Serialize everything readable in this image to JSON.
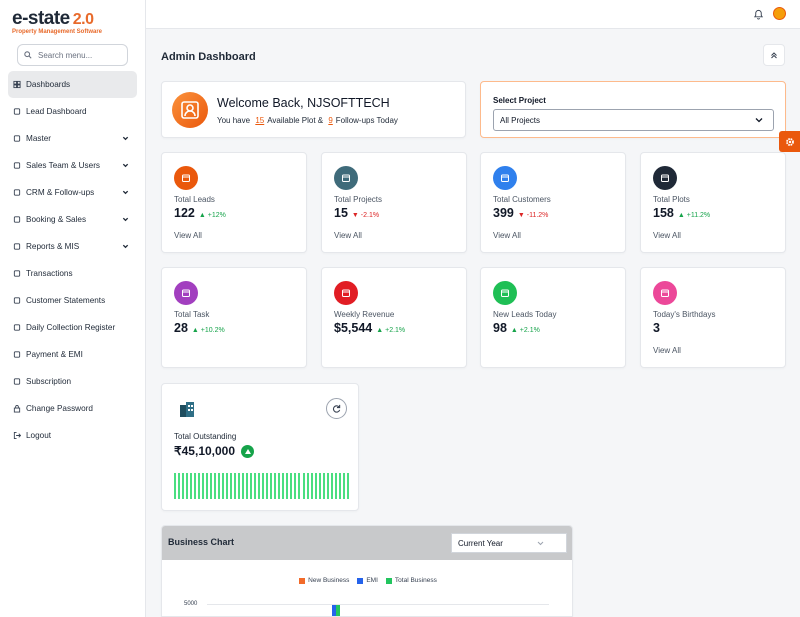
{
  "brand": {
    "name": "e-state",
    "version": "2.0",
    "tagline": "Property Management Software",
    "accent": "#e86a2b"
  },
  "sidebar": {
    "search_placeholder": "Search menu...",
    "items": [
      {
        "label": "Dashboards",
        "icon": "dashboard-icon",
        "active": true,
        "expandable": false
      },
      {
        "label": "Lead Dashboard",
        "icon": "lead-dashboard-icon",
        "expandable": false
      },
      {
        "label": "Master",
        "icon": "folder-icon",
        "expandable": true
      },
      {
        "label": "Sales Team & Users",
        "icon": "users-icon",
        "expandable": true
      },
      {
        "label": "CRM & Follow-ups",
        "icon": "crm-icon",
        "expandable": true
      },
      {
        "label": "Booking & Sales",
        "icon": "home-icon",
        "expandable": true
      },
      {
        "label": "Reports & MIS",
        "icon": "report-icon",
        "expandable": true
      },
      {
        "label": "Transactions",
        "icon": "transactions-icon",
        "expandable": false
      },
      {
        "label": "Customer Statements",
        "icon": "statement-icon",
        "expandable": false
      },
      {
        "label": "Daily Collection Register",
        "icon": "register-icon",
        "expandable": false
      },
      {
        "label": "Payment & EMI",
        "icon": "payment-icon",
        "expandable": false
      },
      {
        "label": "Subscription",
        "icon": "subscription-icon",
        "expandable": false
      },
      {
        "label": "Change Password",
        "icon": "lock-icon",
        "expandable": false
      },
      {
        "label": "Logout",
        "icon": "logout-icon",
        "expandable": false
      }
    ]
  },
  "header": {
    "title": "Admin Dashboard"
  },
  "welcome": {
    "title": "Welcome Back, NJSOFTTECH",
    "prefix": "You have",
    "plots": "15",
    "plots_text": "Available Plot &",
    "followups": "9",
    "followups_text": "Follow-ups Today"
  },
  "project": {
    "label": "Select Project",
    "selected": "All Projects"
  },
  "stats": [
    {
      "label": "Total Leads",
      "value": "122",
      "change": "+12%",
      "direction": "up",
      "link": "View All",
      "color": "#ea580c",
      "icon": "calendar-icon"
    },
    {
      "label": "Total Projects",
      "value": "15",
      "change": "-2.1%",
      "direction": "down",
      "link": "View All",
      "color": "#3f6b7a",
      "icon": "calendar-icon"
    },
    {
      "label": "Total Customers",
      "value": "399",
      "change": "-11.2%",
      "direction": "down",
      "link": "View All",
      "color": "#2f80ed",
      "icon": "users-icon"
    },
    {
      "label": "Total Plots",
      "value": "158",
      "change": "+11.2%",
      "direction": "up",
      "link": "View All",
      "color": "#1f2937",
      "icon": "plot-icon"
    },
    {
      "label": "Total Task",
      "value": "28",
      "change": "+10.2%",
      "direction": "up",
      "link": "",
      "color": "#a23fbf",
      "icon": "task-icon"
    },
    {
      "label": "Weekly Revenue",
      "value": "$5,544",
      "change": "+2.1%",
      "direction": "up",
      "link": "",
      "color": "#e11d24",
      "icon": "calendar-icon"
    },
    {
      "label": "New Leads Today",
      "value": "98",
      "change": "+2.1%",
      "direction": "up",
      "link": "",
      "color": "#1fbf55",
      "icon": "users-icon"
    },
    {
      "label": "Today's Birthdays",
      "value": "3",
      "change": "",
      "direction": "",
      "link": "View All",
      "color": "#ec4899",
      "icon": "cake-icon"
    }
  ],
  "outstanding": {
    "label": "Total Outstanding",
    "value": "₹45,10,000"
  },
  "business_chart": {
    "title": "Business Chart",
    "period": "Current Year",
    "legend": [
      {
        "name": "New Business",
        "color": "#f26b2a"
      },
      {
        "name": "EMI",
        "color": "#2563eb"
      },
      {
        "name": "Total Business",
        "color": "#22c55e"
      }
    ],
    "y_tick": "5000"
  }
}
